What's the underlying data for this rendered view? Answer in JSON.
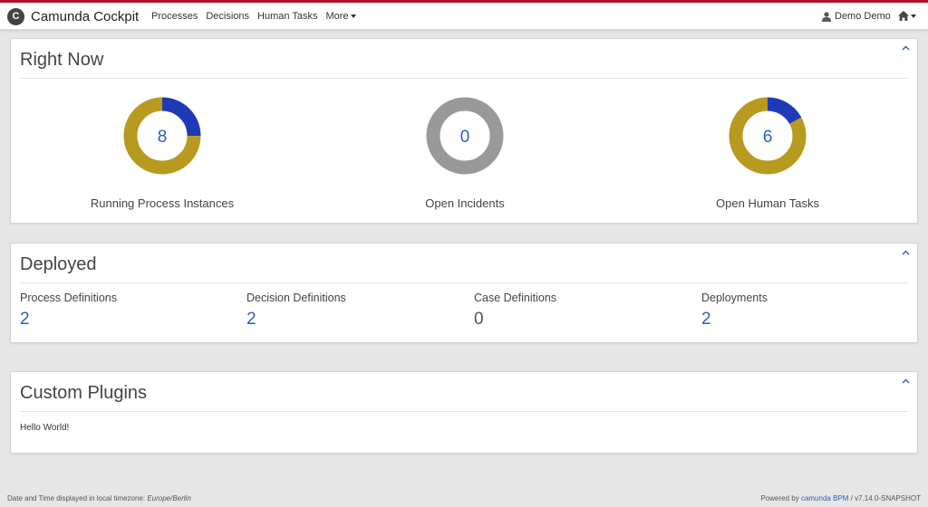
{
  "app": {
    "title": "Camunda Cockpit",
    "logo_letter": "C"
  },
  "nav": {
    "items": [
      "Processes",
      "Decisions",
      "Human Tasks"
    ],
    "more_label": "More"
  },
  "user": {
    "name": "Demo Demo"
  },
  "right_now": {
    "title": "Right Now",
    "widgets": [
      {
        "label": "Running Process Instances",
        "count": "8",
        "segments": [
          {
            "fraction": 0.25,
            "color": "#1f3ab8"
          },
          {
            "fraction": 0.75,
            "color": "#b89a21"
          }
        ]
      },
      {
        "label": "Open Incidents",
        "count": "0",
        "segments": [
          {
            "fraction": 1.0,
            "color": "#999999"
          }
        ]
      },
      {
        "label": "Open Human Tasks",
        "count": "6",
        "segments": [
          {
            "fraction": 0.17,
            "color": "#1f3ab8"
          },
          {
            "fraction": 0.83,
            "color": "#b89a21"
          }
        ]
      }
    ]
  },
  "deployed": {
    "title": "Deployed",
    "stats": [
      {
        "label": "Process Definitions",
        "value": "2"
      },
      {
        "label": "Decision Definitions",
        "value": "2"
      },
      {
        "label": "Case Definitions",
        "value": "0"
      },
      {
        "label": "Deployments",
        "value": "2"
      }
    ]
  },
  "custom_plugins": {
    "title": "Custom Plugins",
    "text": "Hello World!"
  },
  "footer": {
    "timezone_prefix": "Date and Time displayed in local timezone: ",
    "timezone": "Europe/Berlin",
    "powered_prefix": "Powered by ",
    "powered_link": "camunda BPM",
    "version": " / v7.14.0-SNAPSHOT"
  },
  "colors": {
    "accent_red": "#b5152b",
    "link_blue": "#2f5fb3",
    "donut_blue": "#1f3ab8",
    "donut_gold": "#b89a21",
    "donut_grey": "#999999"
  }
}
